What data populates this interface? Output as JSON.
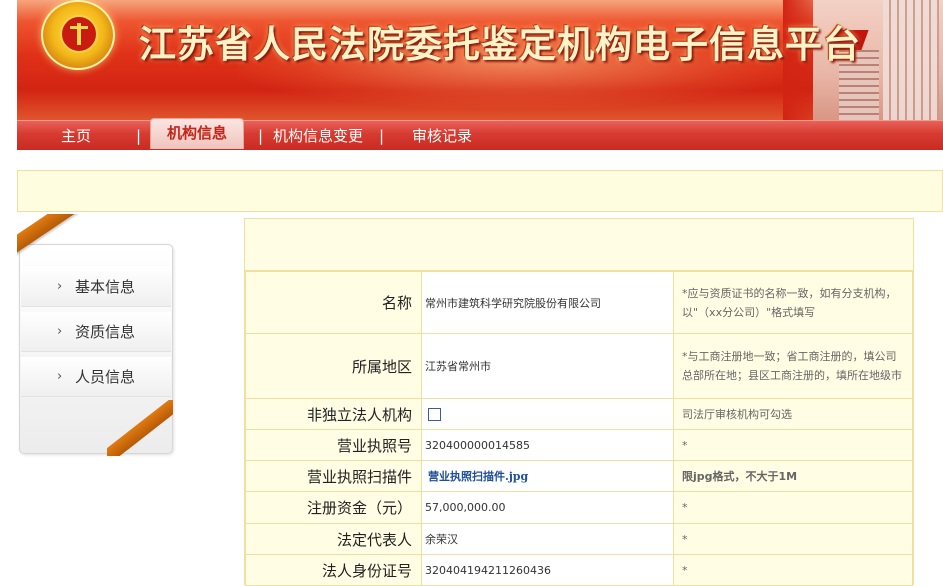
{
  "header": {
    "title": "江苏省人民法院委托鉴定机构电子信息平台",
    "emblem_icon": "court-emblem-icon"
  },
  "nav": {
    "items": [
      {
        "label": "主页",
        "active": false
      },
      {
        "label": "机构信息",
        "active": true
      },
      {
        "label": "机构信息变更",
        "active": false
      },
      {
        "label": "审核记录",
        "active": false
      }
    ],
    "separator": "|"
  },
  "sidebar": {
    "items": [
      {
        "label": "基本信息",
        "icon": "chevron-right-icon"
      },
      {
        "label": "资质信息",
        "icon": "chevron-right-icon"
      },
      {
        "label": "人员信息",
        "icon": "chevron-right-icon"
      }
    ],
    "chevron": "›"
  },
  "form": {
    "rows": [
      {
        "label": "名称",
        "value": "常州市建筑科学研究院股份有限公司",
        "tip": "*应与资质证书的名称一致，如有分支机构，以\"（xx分公司）\"格式填写"
      },
      {
        "label": "所属地区",
        "value": "江苏省常州市",
        "tip": "*与工商注册地一致；省工商注册的，填公司总部所在地；县区工商注册的，填所在地级市"
      },
      {
        "label": "非独立法人机构",
        "value": "",
        "tip": "司法厅审核机构可勾选",
        "checked": false
      },
      {
        "label": "营业执照号",
        "value": "320400000014585",
        "tip": "*"
      },
      {
        "label": "营业执照扫描件",
        "value": "营业执照扫描件.jpg",
        "tip": "限jpg格式，不大于1M"
      },
      {
        "label": "注册资金（元）",
        "value": "57,000,000.00",
        "tip": "*"
      },
      {
        "label": "法定代表人",
        "value": "余荣汉",
        "tip": "*"
      },
      {
        "label": "法人身份证号",
        "value": "320404194211260436",
        "tip": "*"
      }
    ]
  },
  "colors": {
    "banner_red": "#d22413",
    "nav_red": "#d63a30",
    "notice_yellow": "#fffde0",
    "border_yellow": "#f1dfa1",
    "ribbon_orange": "#e07b12",
    "link_blue": "#1f4f9a"
  }
}
